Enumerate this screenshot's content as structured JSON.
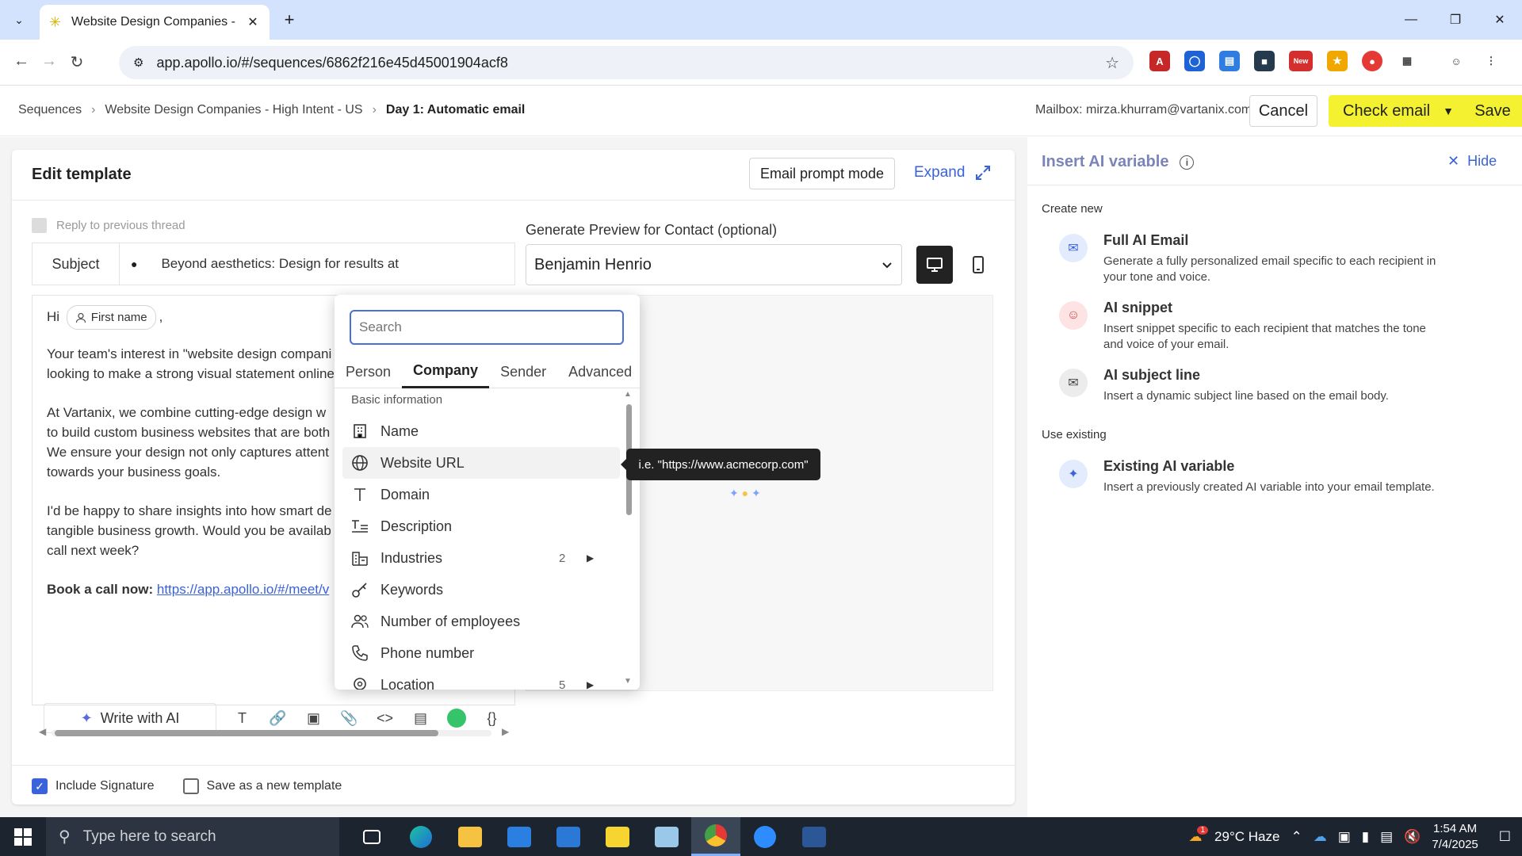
{
  "browser": {
    "tab_title": "Website Design Companies - H",
    "url": "app.apollo.io/#/sequences/6862f216e45d45001904acf8",
    "ext_new_badge": "New"
  },
  "header": {
    "breadcrumb": [
      "Sequences",
      "Website Design Companies - High Intent - US",
      "Day 1: Automatic email"
    ],
    "mailbox": "Mailbox: mirza.khurram@vartanix.com",
    "cancel": "Cancel",
    "check_email": "Check email",
    "save": "Save"
  },
  "editor": {
    "title": "Edit template",
    "prompt_mode": "Email prompt mode",
    "expand": "Expand",
    "reply_label": "Reply to previous thread",
    "subject_label": "Subject",
    "subject_value": "Beyond aesthetics: Design for results at",
    "preview_label": "Generate Preview for Contact (optional)",
    "contact": "Benjamin Henrio",
    "body": {
      "hi": "Hi",
      "chip": "First name",
      "comma": ",",
      "p1a": "Your team's interest in \"website design compani",
      "p1b": "looking to make a strong visual statement online",
      "p2a": "At Vartanix, we combine cutting-edge design w",
      "p2b": "to build custom business websites that are both",
      "p2c": "We ensure your design not only captures attent",
      "p2d": "towards your business goals.",
      "p3a": "I'd be happy to share insights into how smart de",
      "p3b": "tangible business growth. Would you be availab",
      "p3c": "call next week?",
      "cta": "Book a call now:",
      "cta_link": "https://app.apollo.io/#/meet/v"
    },
    "write_ai": "Write with AI",
    "include_signature": "Include Signature",
    "save_template": "Save as a new template"
  },
  "variable_popup": {
    "search_placeholder": "Search",
    "tabs": [
      "Person",
      "Company",
      "Sender",
      "Advanced"
    ],
    "section": "Basic information",
    "items": [
      {
        "label": "Name",
        "icon": "building-icon"
      },
      {
        "label": "Website URL",
        "icon": "globe-icon"
      },
      {
        "label": "Domain",
        "icon": "text-icon"
      },
      {
        "label": "Description",
        "icon": "description-icon"
      },
      {
        "label": "Industries",
        "icon": "industries-icon",
        "count": "2"
      },
      {
        "label": "Keywords",
        "icon": "key-icon"
      },
      {
        "label": "Number of employees",
        "icon": "people-icon"
      },
      {
        "label": "Phone number",
        "icon": "phone-icon"
      },
      {
        "label": "Location",
        "icon": "location-icon",
        "count": "5"
      }
    ],
    "tooltip": "i.e. \"https://www.acmecorp.com\""
  },
  "ai_panel": {
    "title": "Insert AI variable",
    "hide": "Hide",
    "create_new": "Create new",
    "use_existing": "Use existing",
    "options": [
      {
        "title": "Full AI Email",
        "desc": "Generate a fully personalized email specific to each recipient in your tone and voice."
      },
      {
        "title": "AI snippet",
        "desc": "Insert snippet specific to each recipient that matches the tone and voice of your email."
      },
      {
        "title": "AI subject line",
        "desc": "Insert a dynamic subject line based on the email body."
      },
      {
        "title": "Existing AI variable",
        "desc": "Insert a previously created AI variable into your email template."
      }
    ]
  },
  "taskbar": {
    "search_placeholder": "Type here to search",
    "weather": "29°C Haze",
    "weather_badge": "1",
    "time": "1:54 AM",
    "date": "7/4/2025"
  },
  "colors": {
    "accent_yellow": "#f4f230",
    "link_blue": "#3a62d9",
    "panel_title": "#7b84b8"
  }
}
